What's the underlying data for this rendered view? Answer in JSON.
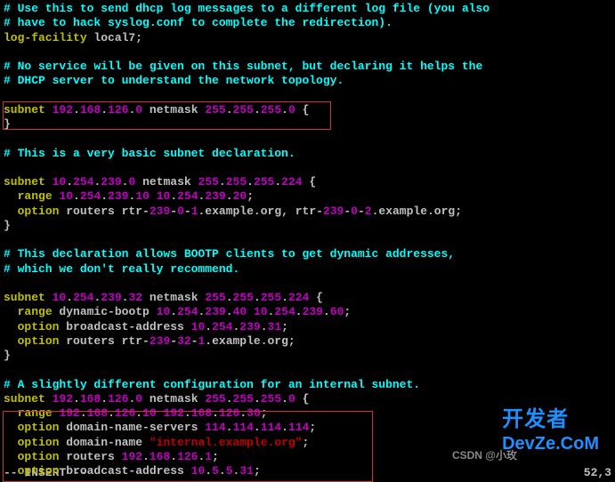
{
  "lines": [
    {
      "cls": "comment",
      "t": "# Use this to send dhcp log messages to a different log file (you also"
    },
    {
      "cls": "comment",
      "t": "# have to hack syslog.conf to complete the redirection)."
    },
    {
      "segs": [
        {
          "cls": "keyword",
          "t": "log-facility"
        },
        {
          "cls": "code",
          "t": " local7;"
        }
      ]
    },
    {
      "cls": "code",
      "t": ""
    },
    {
      "cls": "comment",
      "t": "# No service will be given on this subnet, but declaring it helps the"
    },
    {
      "cls": "comment",
      "t": "# DHCP server to understand the network topology."
    },
    {
      "cls": "code",
      "t": ""
    },
    {
      "segs": [
        {
          "cls": "keyword",
          "t": "subnet"
        },
        {
          "cls": "code",
          "t": " "
        },
        {
          "cls": "number",
          "t": "192"
        },
        {
          "cls": "code",
          "t": "."
        },
        {
          "cls": "number",
          "t": "168"
        },
        {
          "cls": "code",
          "t": "."
        },
        {
          "cls": "number",
          "t": "126"
        },
        {
          "cls": "code",
          "t": "."
        },
        {
          "cls": "number",
          "t": "0"
        },
        {
          "cls": "code",
          "t": " netmask "
        },
        {
          "cls": "number",
          "t": "255"
        },
        {
          "cls": "code",
          "t": "."
        },
        {
          "cls": "number",
          "t": "255"
        },
        {
          "cls": "code",
          "t": "."
        },
        {
          "cls": "number",
          "t": "255"
        },
        {
          "cls": "code",
          "t": "."
        },
        {
          "cls": "number",
          "t": "0"
        },
        {
          "cls": "code",
          "t": " {"
        }
      ]
    },
    {
      "cls": "code",
      "t": "}"
    },
    {
      "cls": "code",
      "t": ""
    },
    {
      "cls": "comment",
      "t": "# This is a very basic subnet declaration."
    },
    {
      "cls": "code",
      "t": ""
    },
    {
      "segs": [
        {
          "cls": "keyword",
          "t": "subnet"
        },
        {
          "cls": "code",
          "t": " "
        },
        {
          "cls": "number",
          "t": "10"
        },
        {
          "cls": "code",
          "t": "."
        },
        {
          "cls": "number",
          "t": "254"
        },
        {
          "cls": "code",
          "t": "."
        },
        {
          "cls": "number",
          "t": "239"
        },
        {
          "cls": "code",
          "t": "."
        },
        {
          "cls": "number",
          "t": "0"
        },
        {
          "cls": "code",
          "t": " netmask "
        },
        {
          "cls": "number",
          "t": "255"
        },
        {
          "cls": "code",
          "t": "."
        },
        {
          "cls": "number",
          "t": "255"
        },
        {
          "cls": "code",
          "t": "."
        },
        {
          "cls": "number",
          "t": "255"
        },
        {
          "cls": "code",
          "t": "."
        },
        {
          "cls": "number",
          "t": "224"
        },
        {
          "cls": "code",
          "t": " {"
        }
      ]
    },
    {
      "segs": [
        {
          "cls": "code",
          "t": "  "
        },
        {
          "cls": "keyword",
          "t": "range"
        },
        {
          "cls": "code",
          "t": " "
        },
        {
          "cls": "number",
          "t": "10"
        },
        {
          "cls": "code",
          "t": "."
        },
        {
          "cls": "number",
          "t": "254"
        },
        {
          "cls": "code",
          "t": "."
        },
        {
          "cls": "number",
          "t": "239"
        },
        {
          "cls": "code",
          "t": "."
        },
        {
          "cls": "number",
          "t": "10"
        },
        {
          "cls": "code",
          "t": " "
        },
        {
          "cls": "number",
          "t": "10"
        },
        {
          "cls": "code",
          "t": "."
        },
        {
          "cls": "number",
          "t": "254"
        },
        {
          "cls": "code",
          "t": "."
        },
        {
          "cls": "number",
          "t": "239"
        },
        {
          "cls": "code",
          "t": "."
        },
        {
          "cls": "number",
          "t": "20"
        },
        {
          "cls": "code",
          "t": ";"
        }
      ]
    },
    {
      "segs": [
        {
          "cls": "code",
          "t": "  "
        },
        {
          "cls": "keyword",
          "t": "option"
        },
        {
          "cls": "code",
          "t": " routers rtr-"
        },
        {
          "cls": "number",
          "t": "239"
        },
        {
          "cls": "code",
          "t": "-"
        },
        {
          "cls": "number",
          "t": "0"
        },
        {
          "cls": "code",
          "t": "-"
        },
        {
          "cls": "number",
          "t": "1"
        },
        {
          "cls": "code",
          "t": ".example.org, rtr-"
        },
        {
          "cls": "number",
          "t": "239"
        },
        {
          "cls": "code",
          "t": "-"
        },
        {
          "cls": "number",
          "t": "0"
        },
        {
          "cls": "code",
          "t": "-"
        },
        {
          "cls": "number",
          "t": "2"
        },
        {
          "cls": "code",
          "t": ".example.org;"
        }
      ]
    },
    {
      "cls": "code",
      "t": "}"
    },
    {
      "cls": "code",
      "t": ""
    },
    {
      "cls": "comment",
      "t": "# This declaration allows BOOTP clients to get dynamic addresses,"
    },
    {
      "cls": "comment",
      "t": "# which we don't really recommend."
    },
    {
      "cls": "code",
      "t": ""
    },
    {
      "segs": [
        {
          "cls": "keyword",
          "t": "subnet"
        },
        {
          "cls": "code",
          "t": " "
        },
        {
          "cls": "number",
          "t": "10"
        },
        {
          "cls": "code",
          "t": "."
        },
        {
          "cls": "number",
          "t": "254"
        },
        {
          "cls": "code",
          "t": "."
        },
        {
          "cls": "number",
          "t": "239"
        },
        {
          "cls": "code",
          "t": "."
        },
        {
          "cls": "number",
          "t": "32"
        },
        {
          "cls": "code",
          "t": " netmask "
        },
        {
          "cls": "number",
          "t": "255"
        },
        {
          "cls": "code",
          "t": "."
        },
        {
          "cls": "number",
          "t": "255"
        },
        {
          "cls": "code",
          "t": "."
        },
        {
          "cls": "number",
          "t": "255"
        },
        {
          "cls": "code",
          "t": "."
        },
        {
          "cls": "number",
          "t": "224"
        },
        {
          "cls": "code",
          "t": " {"
        }
      ]
    },
    {
      "segs": [
        {
          "cls": "code",
          "t": "  "
        },
        {
          "cls": "keyword",
          "t": "range"
        },
        {
          "cls": "code",
          "t": " dynamic-bootp "
        },
        {
          "cls": "number",
          "t": "10"
        },
        {
          "cls": "code",
          "t": "."
        },
        {
          "cls": "number",
          "t": "254"
        },
        {
          "cls": "code",
          "t": "."
        },
        {
          "cls": "number",
          "t": "239"
        },
        {
          "cls": "code",
          "t": "."
        },
        {
          "cls": "number",
          "t": "40"
        },
        {
          "cls": "code",
          "t": " "
        },
        {
          "cls": "number",
          "t": "10"
        },
        {
          "cls": "code",
          "t": "."
        },
        {
          "cls": "number",
          "t": "254"
        },
        {
          "cls": "code",
          "t": "."
        },
        {
          "cls": "number",
          "t": "239"
        },
        {
          "cls": "code",
          "t": "."
        },
        {
          "cls": "number",
          "t": "60"
        },
        {
          "cls": "code",
          "t": ";"
        }
      ]
    },
    {
      "segs": [
        {
          "cls": "code",
          "t": "  "
        },
        {
          "cls": "keyword",
          "t": "option"
        },
        {
          "cls": "code",
          "t": " broadcast-address "
        },
        {
          "cls": "number",
          "t": "10"
        },
        {
          "cls": "code",
          "t": "."
        },
        {
          "cls": "number",
          "t": "254"
        },
        {
          "cls": "code",
          "t": "."
        },
        {
          "cls": "number",
          "t": "239"
        },
        {
          "cls": "code",
          "t": "."
        },
        {
          "cls": "number",
          "t": "31"
        },
        {
          "cls": "code",
          "t": ";"
        }
      ]
    },
    {
      "segs": [
        {
          "cls": "code",
          "t": "  "
        },
        {
          "cls": "keyword",
          "t": "option"
        },
        {
          "cls": "code",
          "t": " routers rtr-"
        },
        {
          "cls": "number",
          "t": "239"
        },
        {
          "cls": "code",
          "t": "-"
        },
        {
          "cls": "number",
          "t": "32"
        },
        {
          "cls": "code",
          "t": "-"
        },
        {
          "cls": "number",
          "t": "1"
        },
        {
          "cls": "code",
          "t": ".example.org;"
        }
      ]
    },
    {
      "cls": "code",
      "t": "}"
    },
    {
      "cls": "code",
      "t": ""
    },
    {
      "cls": "comment",
      "t": "# A slightly different configuration for an internal subnet."
    },
    {
      "segs": [
        {
          "cls": "keyword",
          "t": "subnet"
        },
        {
          "cls": "code",
          "t": " "
        },
        {
          "cls": "number",
          "t": "192"
        },
        {
          "cls": "code",
          "t": "."
        },
        {
          "cls": "number",
          "t": "168"
        },
        {
          "cls": "code",
          "t": "."
        },
        {
          "cls": "number",
          "t": "126"
        },
        {
          "cls": "code",
          "t": "."
        },
        {
          "cls": "number",
          "t": "0"
        },
        {
          "cls": "code",
          "t": " netmask "
        },
        {
          "cls": "number",
          "t": "255"
        },
        {
          "cls": "code",
          "t": "."
        },
        {
          "cls": "number",
          "t": "255"
        },
        {
          "cls": "code",
          "t": "."
        },
        {
          "cls": "number",
          "t": "255"
        },
        {
          "cls": "code",
          "t": "."
        },
        {
          "cls": "number",
          "t": "0"
        },
        {
          "cls": "code",
          "t": " {"
        }
      ]
    },
    {
      "segs": [
        {
          "cls": "code",
          "t": "  "
        },
        {
          "cls": "keyword",
          "t": "range"
        },
        {
          "cls": "code",
          "t": " "
        },
        {
          "cls": "number",
          "t": "192"
        },
        {
          "cls": "code",
          "t": "."
        },
        {
          "cls": "number",
          "t": "168"
        },
        {
          "cls": "code",
          "t": "."
        },
        {
          "cls": "number",
          "t": "126"
        },
        {
          "cls": "code",
          "t": "."
        },
        {
          "cls": "number",
          "t": "10"
        },
        {
          "cls": "code",
          "t": " "
        },
        {
          "cls": "number",
          "t": "192"
        },
        {
          "cls": "code",
          "t": "."
        },
        {
          "cls": "number",
          "t": "168"
        },
        {
          "cls": "code",
          "t": "."
        },
        {
          "cls": "number",
          "t": "126"
        },
        {
          "cls": "code",
          "t": "."
        },
        {
          "cls": "number",
          "t": "30"
        },
        {
          "cls": "code",
          "t": ";"
        }
      ]
    },
    {
      "segs": [
        {
          "cls": "code",
          "t": "  "
        },
        {
          "cls": "keyword",
          "t": "option"
        },
        {
          "cls": "code",
          "t": " domain-name-servers "
        },
        {
          "cls": "number",
          "t": "114"
        },
        {
          "cls": "code",
          "t": "."
        },
        {
          "cls": "number",
          "t": "114"
        },
        {
          "cls": "code",
          "t": "."
        },
        {
          "cls": "number",
          "t": "114"
        },
        {
          "cls": "code",
          "t": "."
        },
        {
          "cls": "number",
          "t": "114"
        },
        {
          "cls": "code",
          "t": ";"
        }
      ]
    },
    {
      "segs": [
        {
          "cls": "code",
          "t": "  "
        },
        {
          "cls": "keyword",
          "t": "option"
        },
        {
          "cls": "code",
          "t": " domain-name "
        },
        {
          "cls": "string",
          "t": "\"internal.example.org\""
        },
        {
          "cls": "code",
          "t": ";"
        }
      ]
    },
    {
      "segs": [
        {
          "cls": "code",
          "t": "  "
        },
        {
          "cls": "keyword",
          "t": "option"
        },
        {
          "cls": "code",
          "t": " routers "
        },
        {
          "cls": "number",
          "t": "192"
        },
        {
          "cls": "code",
          "t": "."
        },
        {
          "cls": "number",
          "t": "168"
        },
        {
          "cls": "code",
          "t": "."
        },
        {
          "cls": "number",
          "t": "126"
        },
        {
          "cls": "code",
          "t": "."
        },
        {
          "cls": "number",
          "t": "1"
        },
        {
          "cls": "code",
          "t": ";"
        }
      ]
    },
    {
      "segs": [
        {
          "cls": "code",
          "t": "  "
        },
        {
          "cls": "keyword",
          "t": "option"
        },
        {
          "cls": "code",
          "t": " broadcast-address "
        },
        {
          "cls": "number",
          "t": "10"
        },
        {
          "cls": "code",
          "t": "."
        },
        {
          "cls": "number",
          "t": "5"
        },
        {
          "cls": "code",
          "t": "."
        },
        {
          "cls": "number",
          "t": "5"
        },
        {
          "cls": "code",
          "t": "."
        },
        {
          "cls": "number",
          "t": "31"
        },
        {
          "cls": "code",
          "t": ";"
        }
      ]
    }
  ],
  "status": {
    "mode": "-- INSERT --",
    "pos": "52,3"
  },
  "watermark": {
    "line1": "开发者",
    "line2": "DevZe.CoM",
    "csdn": "CSDN @小玫"
  }
}
